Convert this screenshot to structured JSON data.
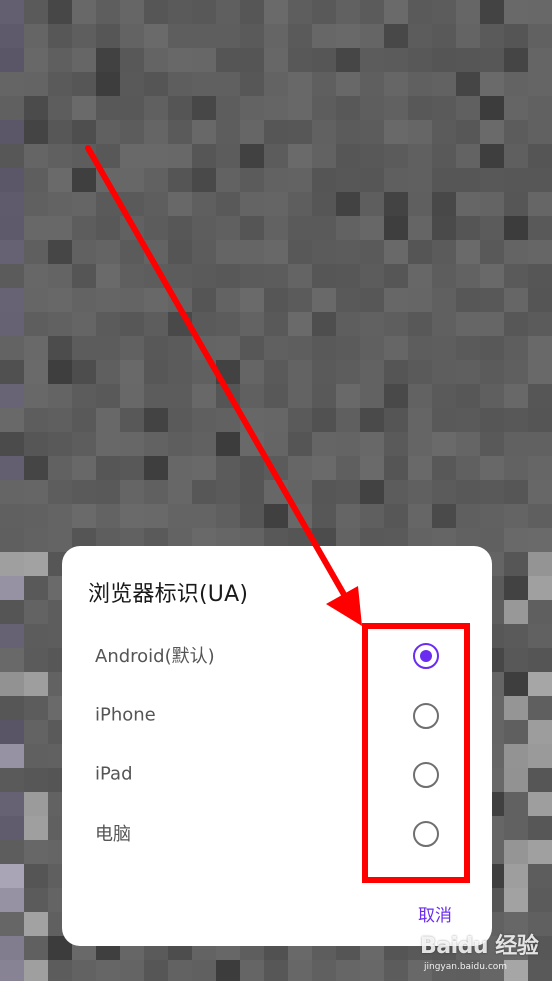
{
  "dialog": {
    "title": "浏览器标识(UA)",
    "options": [
      {
        "label": "Android(默认)",
        "selected": true
      },
      {
        "label": "iPhone",
        "selected": false
      },
      {
        "label": "iPad",
        "selected": false
      },
      {
        "label": "电脑",
        "selected": false
      }
    ],
    "cancel_label": "取消",
    "accent_color": "#6a2cf0"
  },
  "annotation": {
    "color": "#ff0000"
  },
  "watermark": {
    "logo": "Baidu 经验",
    "url": "jingyan.baidu.com"
  }
}
